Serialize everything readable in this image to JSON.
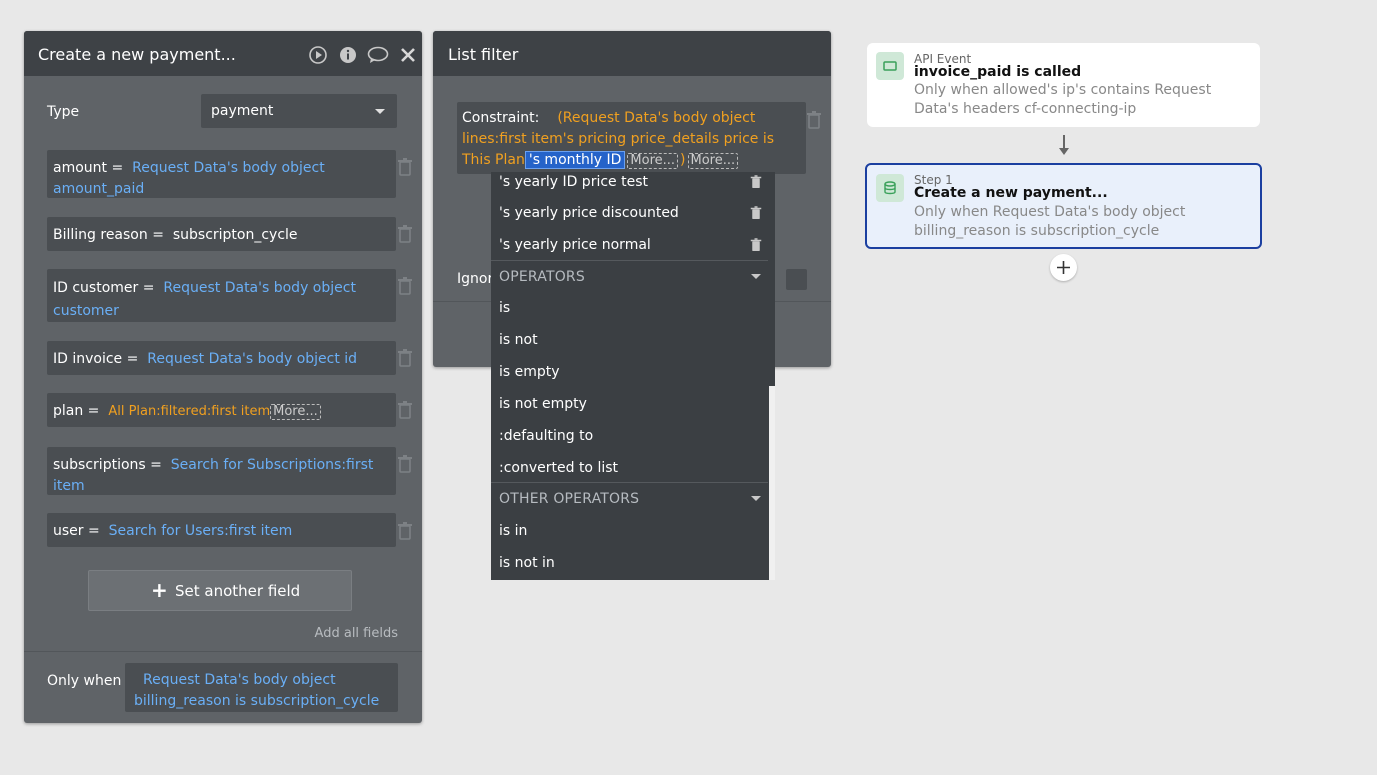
{
  "left_panel": {
    "title": "Create a new payment...",
    "type_label": "Type",
    "type_value": "payment",
    "fields": [
      {
        "name": "amount",
        "eq": " = ",
        "value": "Request Data's body object amount_paid"
      },
      {
        "name": "Billing reason",
        "eq": " = ",
        "value": "subscripton_cycle"
      },
      {
        "name": "ID customer",
        "eq": " = ",
        "value": "Request Data's body object customer"
      },
      {
        "name": "ID invoice",
        "eq": " = ",
        "value": "Request Data's body object id"
      },
      {
        "name": "plan",
        "eq": " = ",
        "value": "All Plan:filtered:first item",
        "more": "More..."
      },
      {
        "name": "subscriptions",
        "eq": " = ",
        "value": "Search for Subscriptions:first item"
      },
      {
        "name": "user",
        "eq": " = ",
        "value": "Search for Users:first item"
      }
    ],
    "set_another_field": "Set another field",
    "add_all_fields": "Add all fields",
    "only_when_label": "Only when",
    "only_when_value": "Request Data's body object billing_reason is subscription_cycle"
  },
  "list_filter": {
    "title": "List filter",
    "constraint_label": "Constraint:",
    "constraint_open": "(",
    "constraint_text": "Request Data's body object lines:first item's pricing price_details price is This Plan",
    "selected_token": "'s monthly ID",
    "more1": "More...",
    "close_paren": ")",
    "more2": "More...",
    "ignore_label": "Ignor"
  },
  "dropdown": {
    "fields": [
      "'s yearly ID price test",
      "'s yearly price discounted",
      "'s yearly price normal"
    ],
    "operators_header": "OPERATORS",
    "operators": [
      "is",
      "is not",
      "is empty",
      "is not empty",
      ":defaulting to",
      ":converted to list"
    ],
    "other_header": "OTHER OPERATORS",
    "other_operators": [
      "is in",
      "is not in"
    ]
  },
  "workflow": {
    "event_kicker": "API Event",
    "event_title": "invoice_paid is called",
    "event_desc": "Only when allowed's ip's contains Request Data's headers cf-connecting-ip",
    "step_kicker": "Step 1",
    "step_title": "Create a new payment...",
    "step_desc": "Only when Request Data's body object billing_reason is subscription_cycle"
  },
  "colors": {
    "dynamic": "#6aaff6",
    "orange": "#f0a020",
    "selected": "#2563c9",
    "step_border": "#1b3fa0"
  },
  "icons": [
    "play-icon",
    "info-icon",
    "comment-icon",
    "close-icon",
    "trash-icon",
    "caret-down-icon",
    "plus-icon",
    "api-icon",
    "database-icon",
    "arrow-down-icon"
  ]
}
